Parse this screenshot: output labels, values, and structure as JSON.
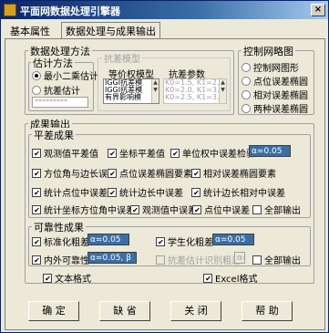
{
  "window": {
    "title": "平面网数据处理引擎器",
    "close_label": "×"
  },
  "tabs": [
    {
      "label": "基本属性",
      "active": false
    },
    {
      "label": "数据处理与成果输出",
      "active": true
    }
  ],
  "data_method": {
    "legend": "数据处理方法",
    "estimation": {
      "legend": "估计方法",
      "options": [
        {
          "label": "最小二乘估计",
          "selected": true
        },
        {
          "label": "抗差估计",
          "selected": false
        }
      ],
      "input_value": "*********"
    },
    "robust_model": {
      "legend": "抗差模型",
      "weight_model": {
        "label": "等价权模型",
        "items": [
          "IGGI抗差模",
          "IGGI抗差模",
          "有界影响模"
        ]
      },
      "params": {
        "label": "抗差参数",
        "items": [
          "K0=1.5, K1=2.",
          "K0=2.0, K1=3.",
          "K0=2.5, K1=3."
        ]
      }
    }
  },
  "control_net": {
    "legend": "控制网略图",
    "options": [
      {
        "label": "控制网图形",
        "selected": false
      },
      {
        "label": "点位误差椭圆",
        "selected": false
      },
      {
        "label": "相对误差椭圆",
        "selected": false
      },
      {
        "label": "两种误差椭圆",
        "selected": false
      }
    ]
  },
  "results_output": {
    "legend": "成果输出",
    "adjustment": {
      "legend": "平差成果",
      "items": [
        {
          "label": "观测值平差值",
          "checked": true
        },
        {
          "label": "坐标平差值",
          "checked": true
        },
        {
          "label": "单位权中误差检验",
          "checked": true
        },
        {
          "label": "方位角与边长误差",
          "checked": true
        },
        {
          "label": "点位误差椭圆要素",
          "checked": true
        },
        {
          "label": "相对误差椭圆要素",
          "checked": true
        },
        {
          "label": "统计点位中误差",
          "checked": true
        },
        {
          "label": "统计边长中误差",
          "checked": true
        },
        {
          "label": "统计边长相对中误差",
          "checked": true
        },
        {
          "label": "统计坐标方位角中误差",
          "checked": true
        },
        {
          "label": "观测值中误差",
          "checked": true
        },
        {
          "label": "点位中误差",
          "checked": true
        },
        {
          "label": "全部输出",
          "checked": false
        }
      ],
      "alpha_value": "α=0.05"
    },
    "reliability": {
      "legend": "可靠性成果",
      "items": [
        {
          "label": "标准化粗差",
          "checked": true
        },
        {
          "label": "学生化粗差",
          "checked": true
        },
        {
          "label": "内外可靠性",
          "checked": true
        },
        {
          "label": "抗差估计识别粗差",
          "checked": false
        },
        {
          "label": "全部输出",
          "checked": false
        }
      ],
      "alpha_std": "α=0.05",
      "alpha_student": "α=0.05",
      "alpha_reliability": "α=0.05, β",
      "alpha_robust": "α=0.05"
    },
    "formats": [
      {
        "label": "文本格式",
        "checked": true
      },
      {
        "label": "Excel格式",
        "checked": true
      }
    ]
  },
  "buttons": {
    "ok": "确 定",
    "default": "缺 省",
    "close": "关 闭",
    "help": "帮 助"
  }
}
